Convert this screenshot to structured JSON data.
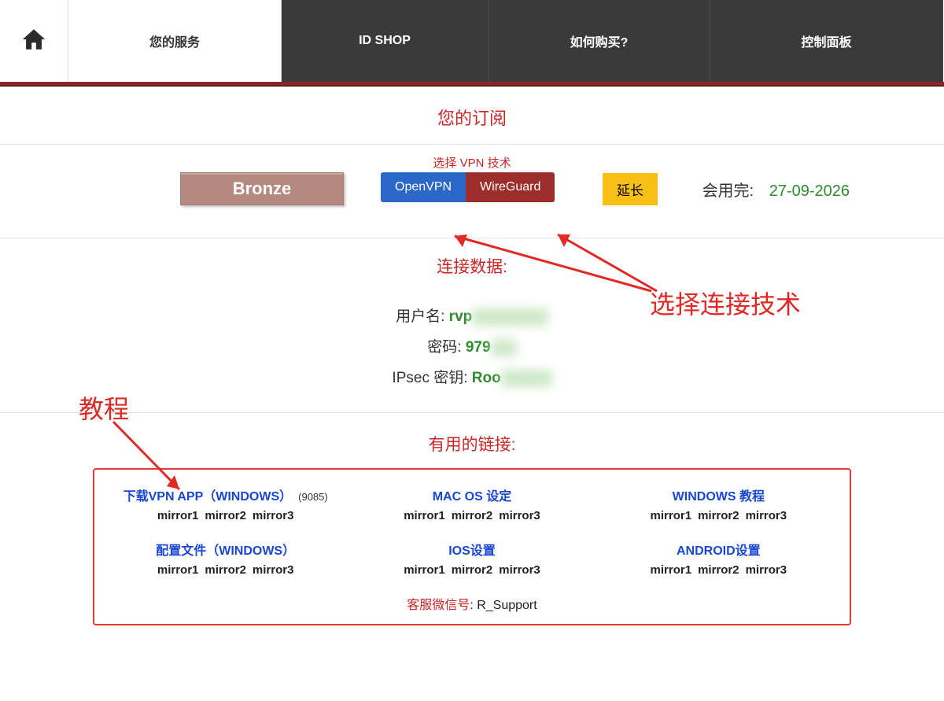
{
  "nav": {
    "services": "您的服务",
    "shop": "ID SHOP",
    "how": "如何购买?",
    "panel": "控制面板"
  },
  "subscription_title": "您的订阅",
  "vpn_tech_label": "选择 VPN 技术",
  "plan_name": "Bronze",
  "tech": {
    "openvpn": "OpenVPN",
    "wireguard": "WireGuard"
  },
  "extend": "延长",
  "expiry_label": "会用完:",
  "expiry_date": "27-09-2026",
  "conn": {
    "title": "连接数据:",
    "user_label": "用户名:",
    "user_prefix": "rvp",
    "user_blur": "xxxxxxxx",
    "pass_label": "密码:",
    "pass_prefix": "979",
    "pass_blur": "xx",
    "ipsec_label": "IPsec 密钥:",
    "ipsec_prefix": "Roo",
    "ipsec_blur": "xxxxx"
  },
  "links_title": "有用的链接:",
  "links": [
    {
      "title": "下载VPN APP（WINDOWS）",
      "count": "(9085)",
      "mirrors": [
        "mirror1",
        "mirror2",
        "mirror3"
      ]
    },
    {
      "title": "MAC OS 设定",
      "mirrors": [
        "mirror1",
        "mirror2",
        "mirror3"
      ]
    },
    {
      "title": "WINDOWS 教程",
      "mirrors": [
        "mirror1",
        "mirror2",
        "mirror3"
      ]
    },
    {
      "title": "配置文件（WINDOWS）",
      "mirrors": [
        "mirror1",
        "mirror2",
        "mirror3"
      ]
    },
    {
      "title": "IOS设置",
      "mirrors": [
        "mirror1",
        "mirror2",
        "mirror3"
      ]
    },
    {
      "title": "ANDROID设置",
      "mirrors": [
        "mirror1",
        "mirror2",
        "mirror3"
      ]
    }
  ],
  "support_label": "客服微信号",
  "support_value": "R_Support",
  "annot": {
    "select_tech": "选择连接技术",
    "tutorial": "教程"
  }
}
